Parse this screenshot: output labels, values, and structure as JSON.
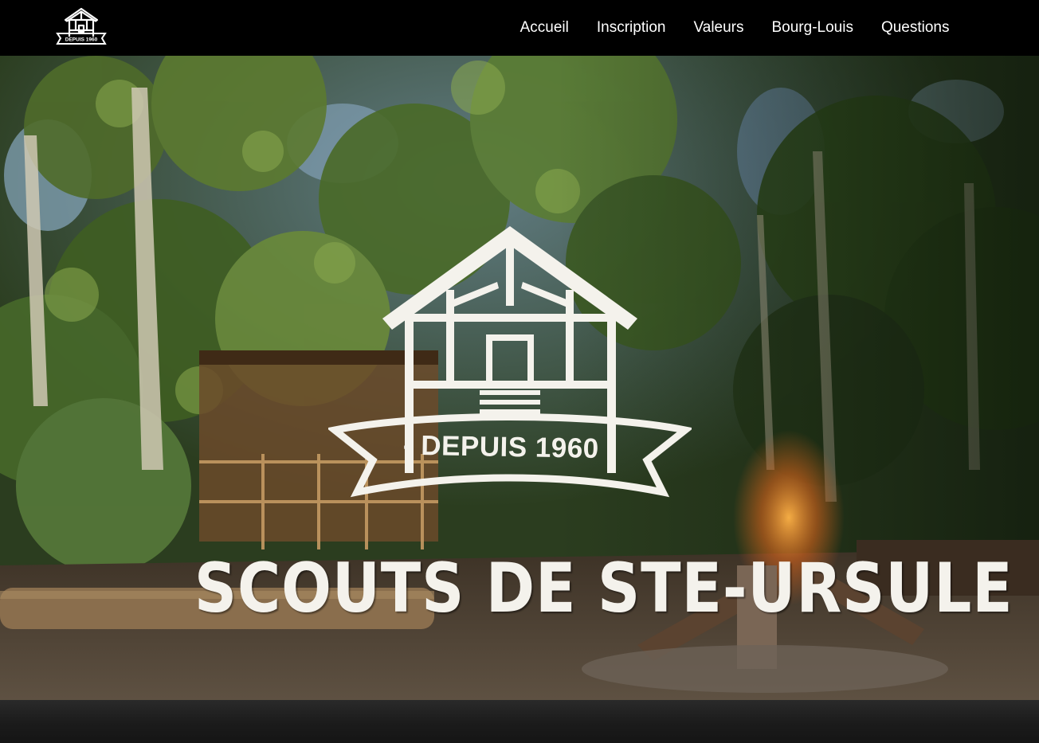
{
  "header": {
    "logo_icon": "cabin-logo-icon",
    "logo_caption": "DEPUIS 1960",
    "nav": [
      {
        "label": "Accueil"
      },
      {
        "label": "Inscription"
      },
      {
        "label": "Valeurs"
      },
      {
        "label": "Bourg-Louis"
      },
      {
        "label": "Questions"
      }
    ]
  },
  "hero": {
    "background_image": "forest-campsite-photo",
    "emblem_icon": "cabin-emblem-icon",
    "tagline": "- DEPUIS 1960 -",
    "title": "SCOUTS DE STE-URSULE"
  },
  "colors": {
    "navbar": "#000000",
    "text": "#ffffff",
    "emblem": "#f4f2ec"
  }
}
